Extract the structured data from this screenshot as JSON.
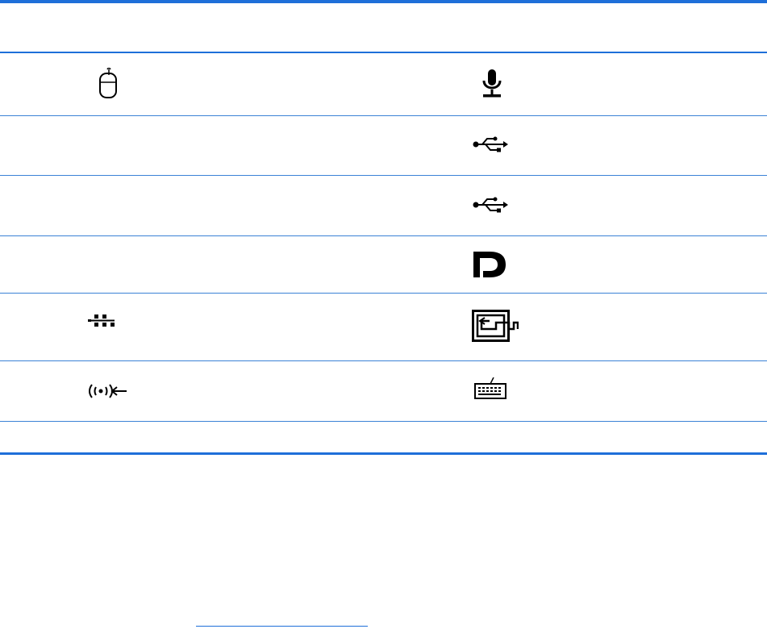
{
  "accent_color": "#1e6fd9",
  "rows": [
    {
      "left_icon": "mouse-icon",
      "right_icon": "microphone-icon"
    },
    {
      "left_icon": "",
      "right_icon": "usb-icon"
    },
    {
      "left_icon": "",
      "right_icon": "usb-icon"
    },
    {
      "left_icon": "",
      "right_icon": "displayport-icon"
    },
    {
      "left_icon": "network-icon",
      "right_icon": "serial-port-icon"
    },
    {
      "left_icon": "audio-line-in-icon",
      "right_icon": "keyboard-icon"
    },
    {
      "left_icon": "",
      "right_icon": ""
    }
  ]
}
